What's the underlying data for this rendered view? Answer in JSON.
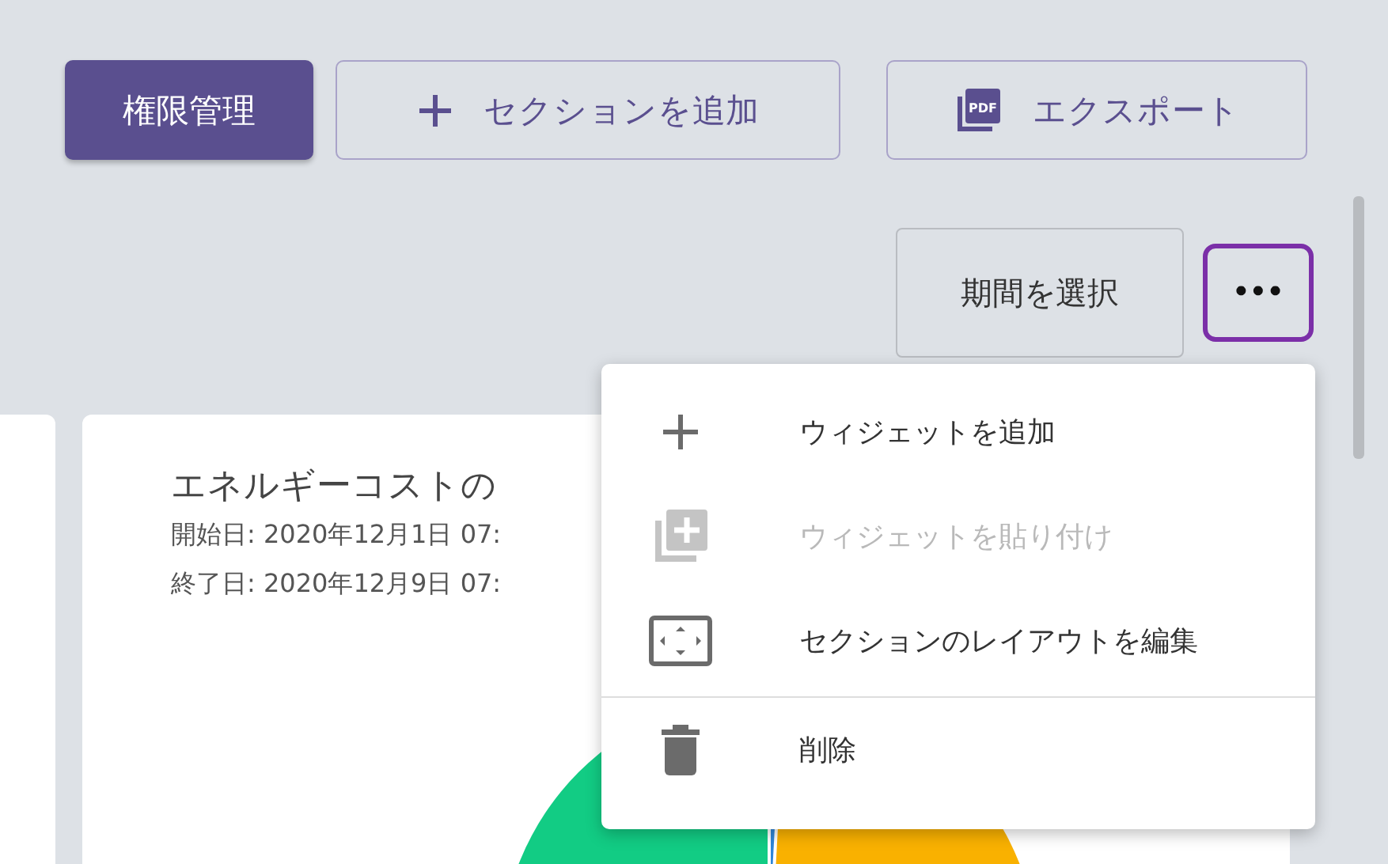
{
  "toolbar": {
    "buttons": [
      {
        "kind": "primary",
        "label": "権限管理"
      },
      {
        "kind": "add",
        "label": "セクションを追加"
      },
      {
        "kind": "export",
        "label": "エクスポート",
        "icon_text": "PDF"
      }
    ]
  },
  "period_button": {
    "label": "期間を選択"
  },
  "more_button": {
    "label": "•••",
    "focused": true
  },
  "card": {
    "title": "エネルギーコストの",
    "lines": [
      "開始日: 2020年12月1日 07:",
      "終了日: 2020年12月9日 07:"
    ]
  },
  "menu": {
    "items": [
      {
        "kind": "add",
        "label": "ウィジェットを追加",
        "disabled": false,
        "separated": false
      },
      {
        "kind": "paste",
        "label": "ウィジェットを貼り付け",
        "disabled": true,
        "separated": false
      },
      {
        "kind": "layout",
        "label": "セクションのレイアウトを編集",
        "disabled": false,
        "separated": false
      },
      {
        "kind": "delete",
        "label": "削除",
        "disabled": false,
        "separated": true
      }
    ]
  }
}
